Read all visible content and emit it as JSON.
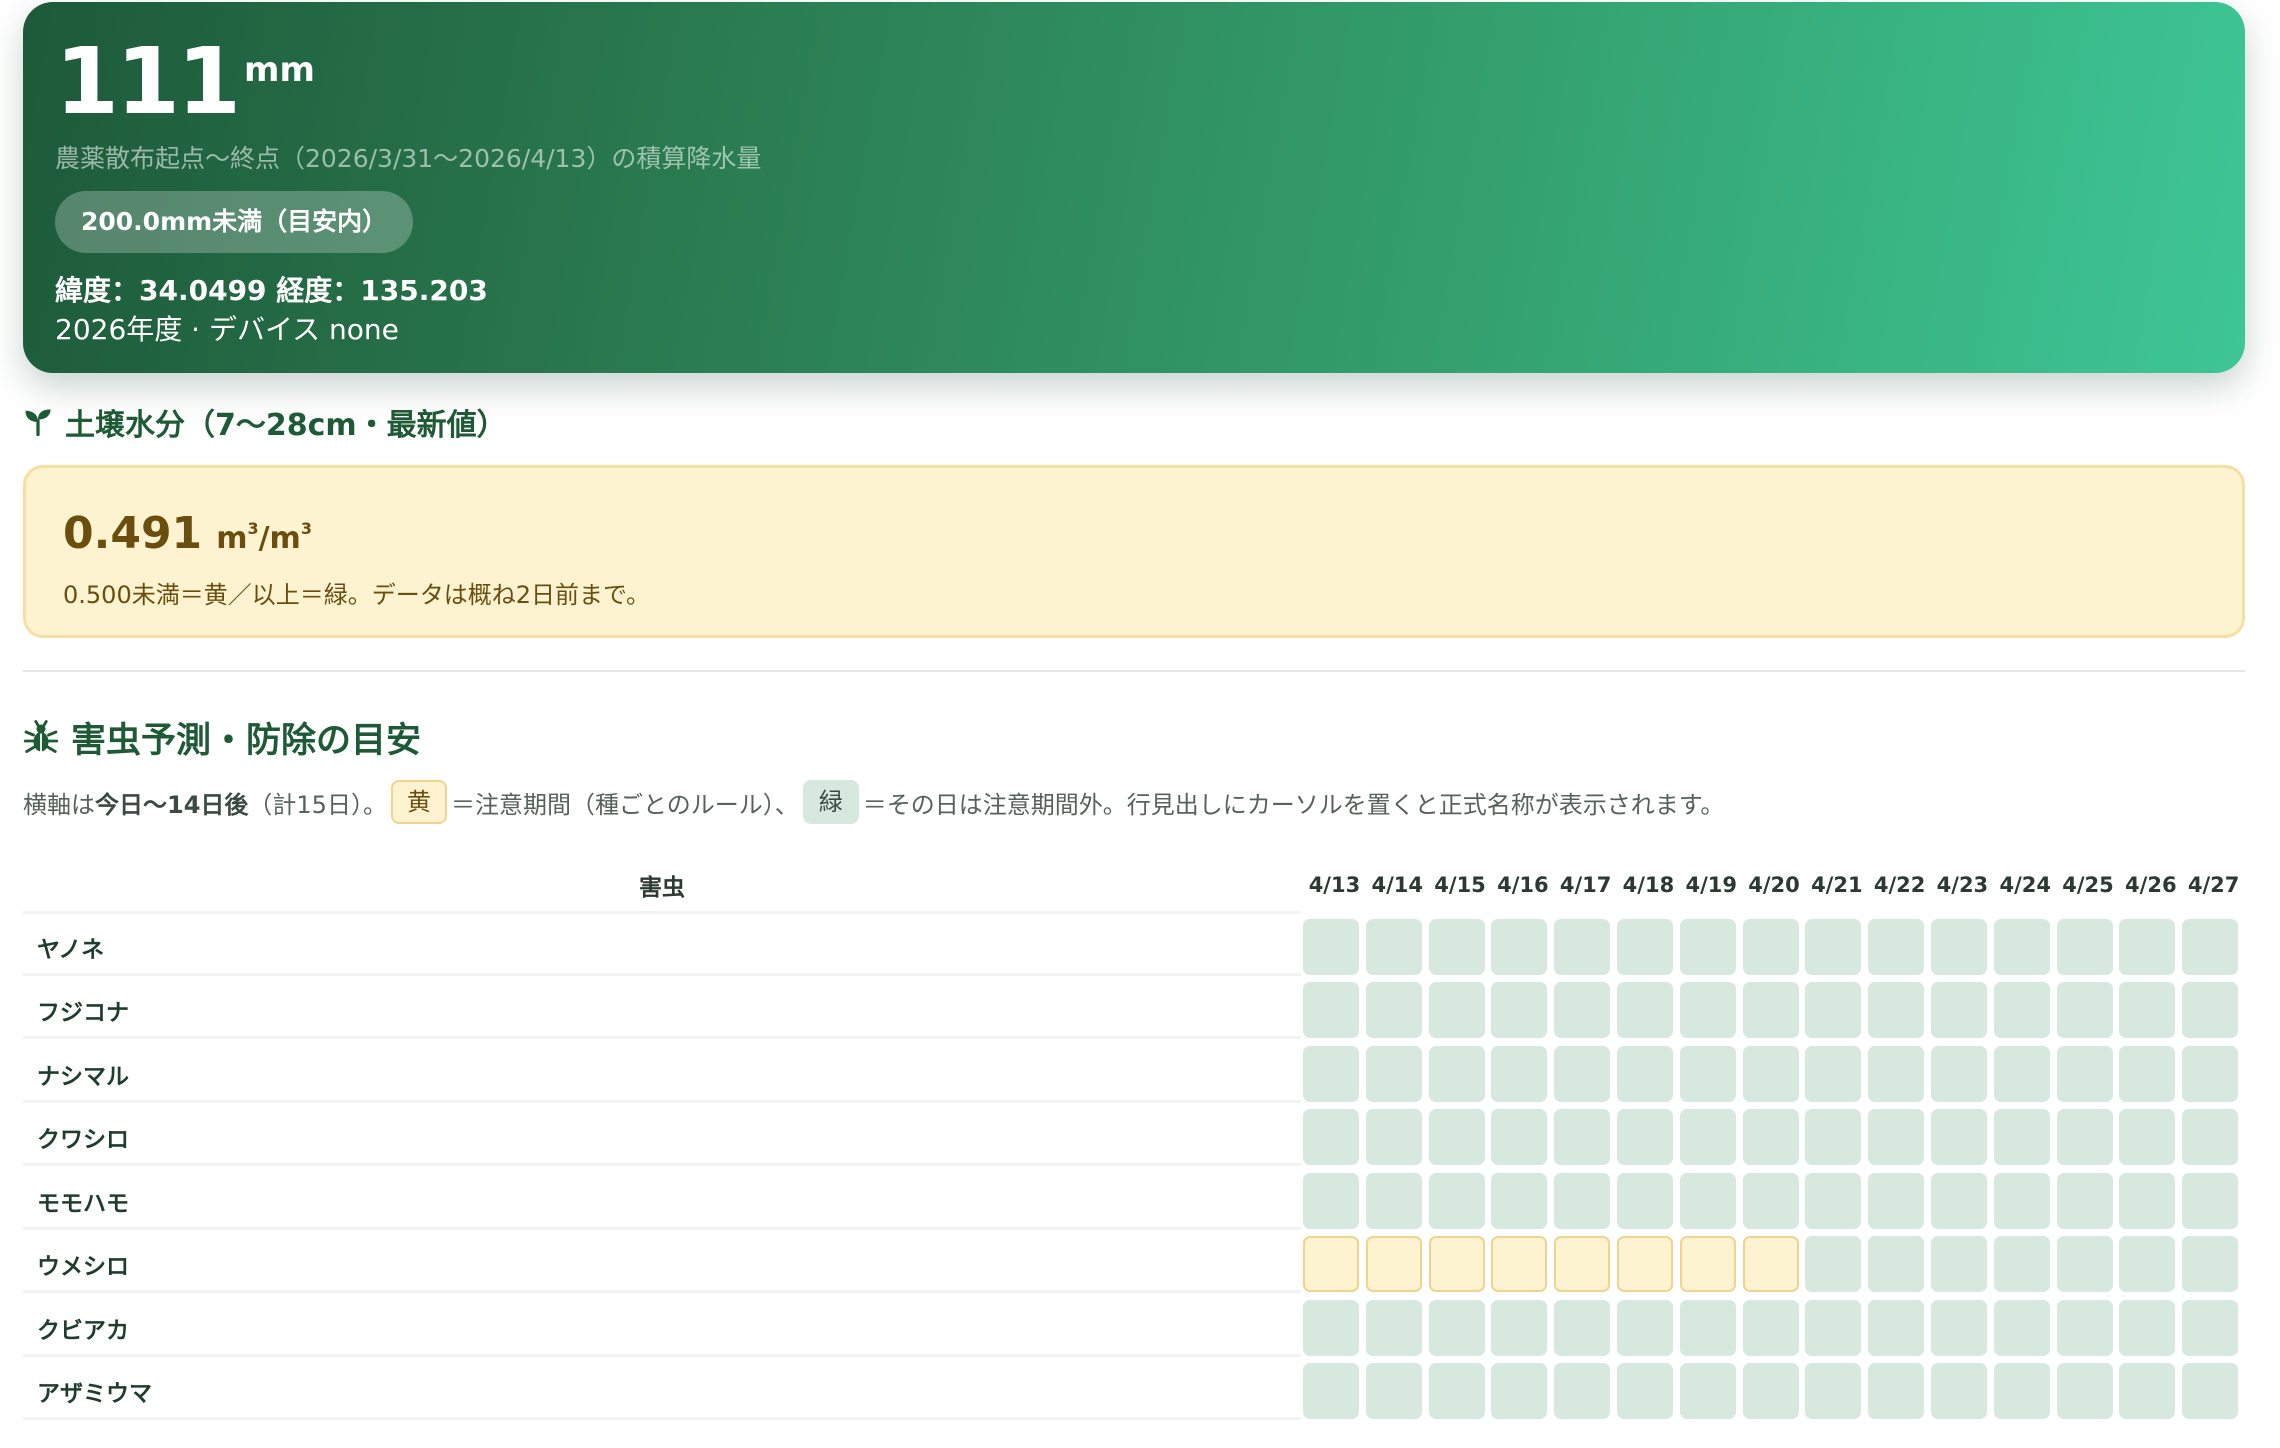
{
  "hero": {
    "value": "111",
    "unit": "mm",
    "caption": "農薬散布起点〜終点（2026/3/31〜2026/4/13）の積算降水量",
    "badge": "200.0mm未満（目安内）",
    "coords": "緯度：34.0499 経度：135.203",
    "year_device": "2026年度 · デバイス none"
  },
  "soil": {
    "title": "土壌水分（7〜28cm・最新値）",
    "value": "0.491",
    "unit_base": "m",
    "unit_sup": "3",
    "unit_sep": "/m",
    "unit_sup2": "3",
    "note": "0.500未満＝黄／以上＝緑。データは概ね2日前まで。"
  },
  "pest": {
    "title": "害虫予測・防除の目安",
    "legend": {
      "prefix": "横軸は",
      "bold": "今日〜14日後",
      "count": "（計15日）。",
      "yellow_chip": "黄",
      "yellow_text": "＝注意期間（種ごとのルール）、",
      "green_chip": "緑",
      "green_text": "＝その日は注意期間外。行見出しにカーソルを置くと正式名称が表示されます。"
    },
    "column_header": "害虫",
    "dates": [
      "4/13",
      "4/14",
      "4/15",
      "4/16",
      "4/17",
      "4/18",
      "4/19",
      "4/20",
      "4/21",
      "4/22",
      "4/23",
      "4/24",
      "4/25",
      "4/26",
      "4/27"
    ],
    "rows": [
      {
        "name": "ヤノネ",
        "status": [
          "g",
          "g",
          "g",
          "g",
          "g",
          "g",
          "g",
          "g",
          "g",
          "g",
          "g",
          "g",
          "g",
          "g",
          "g"
        ]
      },
      {
        "name": "フジコナ",
        "status": [
          "g",
          "g",
          "g",
          "g",
          "g",
          "g",
          "g",
          "g",
          "g",
          "g",
          "g",
          "g",
          "g",
          "g",
          "g"
        ]
      },
      {
        "name": "ナシマル",
        "status": [
          "g",
          "g",
          "g",
          "g",
          "g",
          "g",
          "g",
          "g",
          "g",
          "g",
          "g",
          "g",
          "g",
          "g",
          "g"
        ]
      },
      {
        "name": "クワシロ",
        "status": [
          "g",
          "g",
          "g",
          "g",
          "g",
          "g",
          "g",
          "g",
          "g",
          "g",
          "g",
          "g",
          "g",
          "g",
          "g"
        ]
      },
      {
        "name": "モモハモ",
        "status": [
          "g",
          "g",
          "g",
          "g",
          "g",
          "g",
          "g",
          "g",
          "g",
          "g",
          "g",
          "g",
          "g",
          "g",
          "g"
        ]
      },
      {
        "name": "ウメシロ",
        "status": [
          "y",
          "y",
          "y",
          "y",
          "y",
          "y",
          "y",
          "y",
          "g",
          "g",
          "g",
          "g",
          "g",
          "g",
          "g"
        ]
      },
      {
        "name": "クビアカ",
        "status": [
          "g",
          "g",
          "g",
          "g",
          "g",
          "g",
          "g",
          "g",
          "g",
          "g",
          "g",
          "g",
          "g",
          "g",
          "g"
        ]
      },
      {
        "name": "アザミウマ",
        "status": [
          "g",
          "g",
          "g",
          "g",
          "g",
          "g",
          "g",
          "g",
          "g",
          "g",
          "g",
          "g",
          "g",
          "g",
          "g"
        ]
      }
    ]
  },
  "colors": {
    "attention_yellow": "#fdf3d0",
    "outside_green": "#d7e8df",
    "brand_green": "#1f5a36"
  }
}
